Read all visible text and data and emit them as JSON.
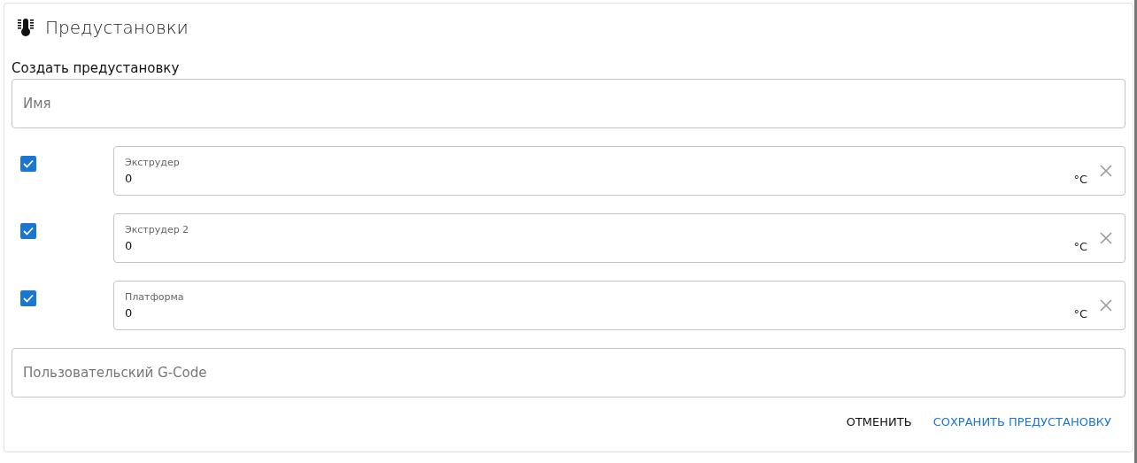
{
  "title": "Предустановки",
  "section_label": "Создать предустановку",
  "name_field": {
    "placeholder": "Имя"
  },
  "heaters": [
    {
      "label": "Экструдер",
      "value": "0",
      "unit": "°C",
      "checked": true
    },
    {
      "label": "Экструдер 2",
      "value": "0",
      "unit": "°C",
      "checked": true
    },
    {
      "label": "Платформа",
      "value": "0",
      "unit": "°C",
      "checked": true
    }
  ],
  "gcode_field": {
    "placeholder": "Пользовательский G-Code"
  },
  "buttons": [
    {
      "label": "ОТМЕНИТЬ",
      "kind": "cancel"
    },
    {
      "label": "СОХРАНИТЬ ПРЕДУСТАНОВКУ",
      "kind": "primary"
    }
  ]
}
